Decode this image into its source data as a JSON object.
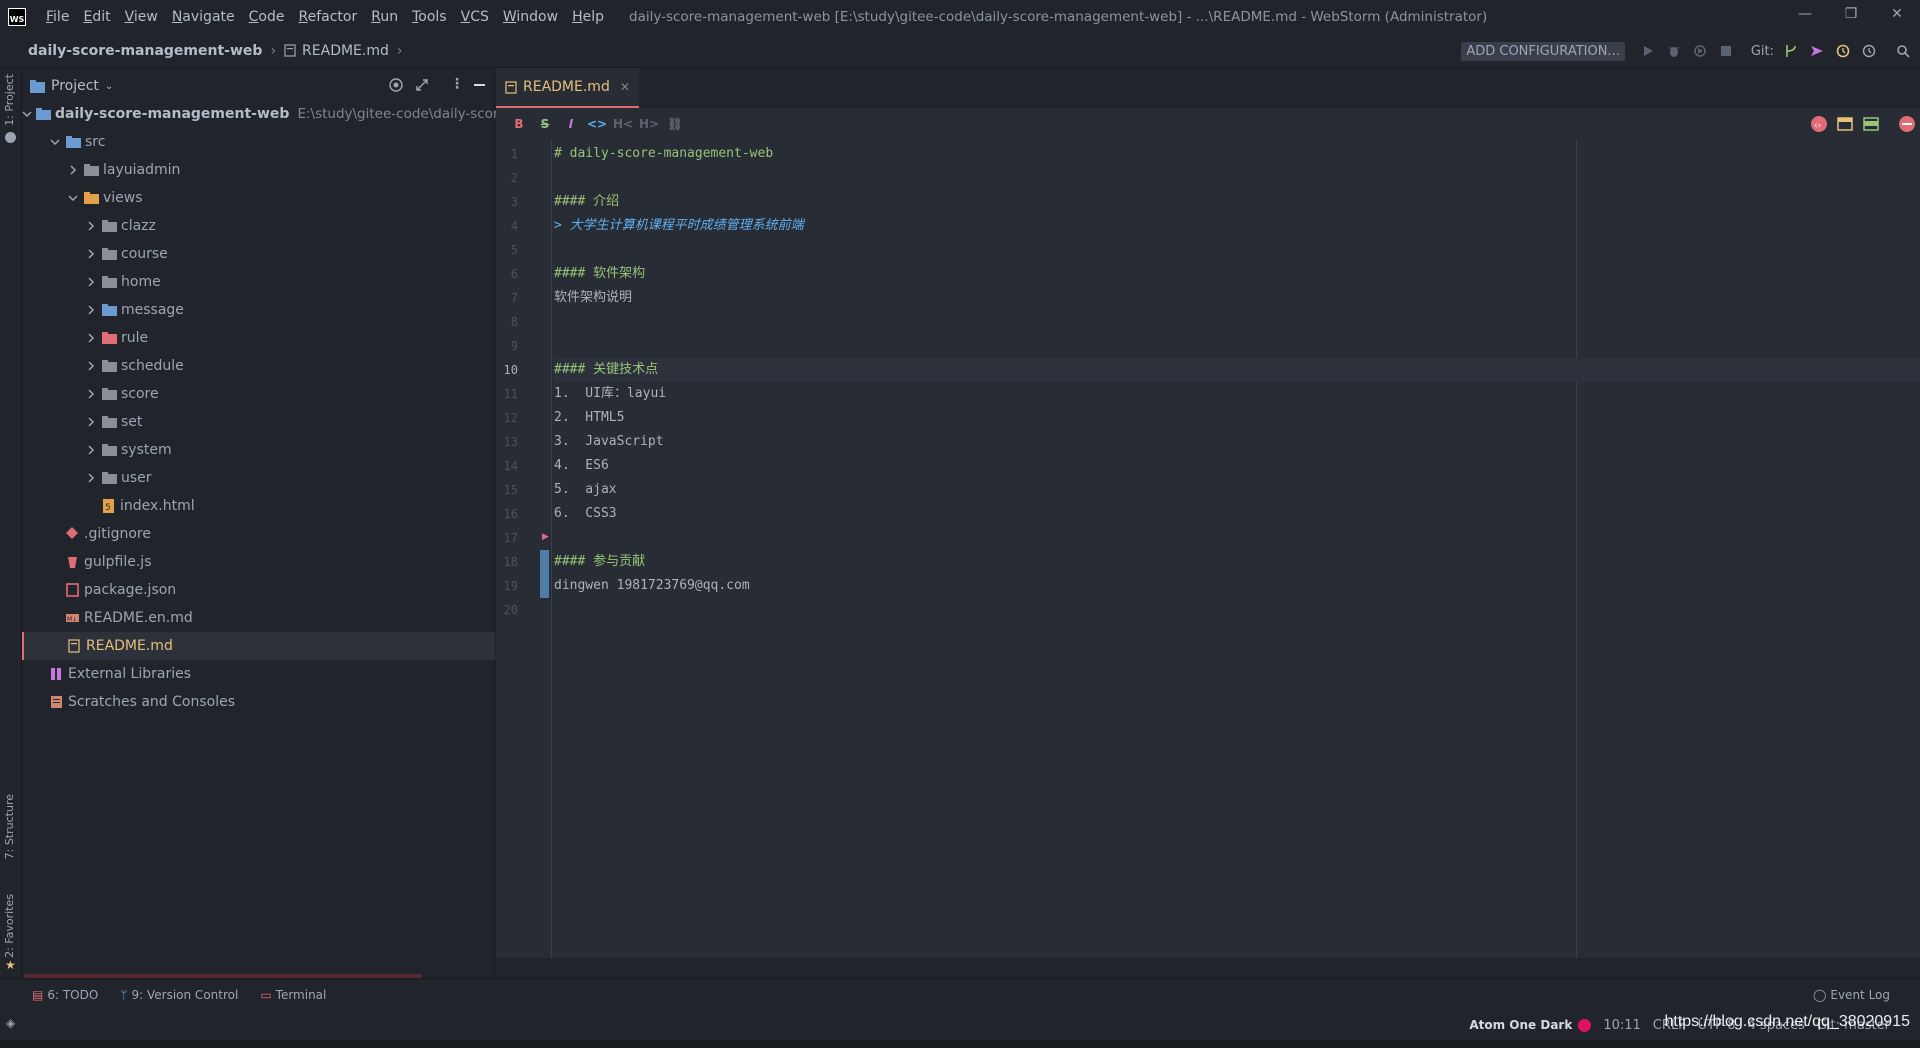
{
  "titlebar": {
    "logo": "WS",
    "menu": [
      "File",
      "Edit",
      "View",
      "Navigate",
      "Code",
      "Refactor",
      "Run",
      "Tools",
      "VCS",
      "Window",
      "Help"
    ],
    "window_title": "daily-score-management-web [E:\\study\\gitee-code\\daily-score-management-web] - ...\\README.md - WebStorm (Administrator)"
  },
  "navbar": {
    "breadcrumbs": [
      "daily-score-management-web",
      "README.md"
    ],
    "add_configuration": "ADD CONFIGURATION...",
    "git_label": "Git:"
  },
  "left_strip": {
    "project_tab": "1: Project",
    "structure_tab": "7: Structure",
    "favorites_tab": "2: Favorites"
  },
  "project_panel": {
    "title": "Project",
    "root": {
      "name": "daily-score-management-web",
      "path": "E:\\study\\gitee-code\\daily-score-man"
    },
    "tree": [
      {
        "label": "src",
        "kind": "folder",
        "expanded": true,
        "depth": 1
      },
      {
        "label": "layuiadmin",
        "kind": "folder",
        "expanded": false,
        "depth": 2
      },
      {
        "label": "views",
        "kind": "folder-orange",
        "expanded": true,
        "depth": 2
      },
      {
        "label": "clazz",
        "kind": "folder",
        "expanded": false,
        "depth": 3
      },
      {
        "label": "course",
        "kind": "folder",
        "expanded": false,
        "depth": 3
      },
      {
        "label": "home",
        "kind": "folder",
        "expanded": false,
        "depth": 3
      },
      {
        "label": "message",
        "kind": "folder-blue",
        "expanded": false,
        "depth": 3
      },
      {
        "label": "rule",
        "kind": "folder-red",
        "expanded": false,
        "depth": 3
      },
      {
        "label": "schedule",
        "kind": "folder",
        "expanded": false,
        "depth": 3
      },
      {
        "label": "score",
        "kind": "folder",
        "expanded": false,
        "depth": 3
      },
      {
        "label": "set",
        "kind": "folder",
        "expanded": false,
        "depth": 3
      },
      {
        "label": "system",
        "kind": "folder",
        "expanded": false,
        "depth": 3
      },
      {
        "label": "user",
        "kind": "folder",
        "expanded": false,
        "depth": 3
      },
      {
        "label": "index.html",
        "kind": "html",
        "depth": 3
      },
      {
        "label": ".gitignore",
        "kind": "git",
        "depth": 1
      },
      {
        "label": "gulpfile.js",
        "kind": "gulp",
        "depth": 1
      },
      {
        "label": "package.json",
        "kind": "npm",
        "depth": 1
      },
      {
        "label": "README.en.md",
        "kind": "md",
        "depth": 1
      },
      {
        "label": "README.md",
        "kind": "md-selected",
        "depth": 1,
        "selected": true
      },
      {
        "label": "External Libraries",
        "kind": "lib",
        "depth": 0
      },
      {
        "label": "Scratches and Consoles",
        "kind": "scratch",
        "depth": 0
      }
    ]
  },
  "editor": {
    "tab_label": "README.md",
    "toolbar": [
      "B",
      "S",
      "I",
      "<>",
      "H<",
      "H>",
      "link"
    ],
    "current_line": 10,
    "lines": [
      {
        "n": 1,
        "text": "# daily-score-management-web",
        "style": "h"
      },
      {
        "n": 2,
        "text": "",
        "style": ""
      },
      {
        "n": 3,
        "text": "#### 介绍",
        "style": "h"
      },
      {
        "n": 4,
        "text": "> 大学生计算机课程平时成绩管理系统前端",
        "style": "bq"
      },
      {
        "n": 5,
        "text": "",
        "style": ""
      },
      {
        "n": 6,
        "text": "#### 软件架构",
        "style": "h"
      },
      {
        "n": 7,
        "text": "软件架构说明",
        "style": ""
      },
      {
        "n": 8,
        "text": "",
        "style": ""
      },
      {
        "n": 9,
        "text": "",
        "style": ""
      },
      {
        "n": 10,
        "text": "#### 关键技术点",
        "style": "h"
      },
      {
        "n": 11,
        "text": "1.  UI库：layui",
        "style": ""
      },
      {
        "n": 12,
        "text": "2.  HTML5",
        "style": ""
      },
      {
        "n": 13,
        "text": "3.  JavaScript",
        "style": ""
      },
      {
        "n": 14,
        "text": "4.  ES6",
        "style": ""
      },
      {
        "n": 15,
        "text": "5.  ajax",
        "style": ""
      },
      {
        "n": 16,
        "text": "6.  CSS3",
        "style": ""
      },
      {
        "n": 17,
        "text": "",
        "style": ""
      },
      {
        "n": 18,
        "text": "#### 参与贡献",
        "style": "h"
      },
      {
        "n": 19,
        "text": "dingwen 1981723769@qq.com",
        "style": ""
      },
      {
        "n": 20,
        "text": "",
        "style": ""
      }
    ]
  },
  "bottom_tools": {
    "todo": "6: TODO",
    "vcs": "9: Version Control",
    "terminal": "Terminal",
    "event_log": "Event Log"
  },
  "statusbar": {
    "theme": "Atom One Dark",
    "position": "10:11",
    "line_sep": "CRLF",
    "encoding": "UTF-8",
    "indent": "4 spaces",
    "git_branch": "Git: master"
  },
  "watermark": "https://blog.csdn.net/qq_38020915",
  "colors": {
    "accent": "#e06c75",
    "heading": "#98c379",
    "blockquote": "#61afef",
    "background": "#282c34",
    "panel": "#21252b"
  }
}
